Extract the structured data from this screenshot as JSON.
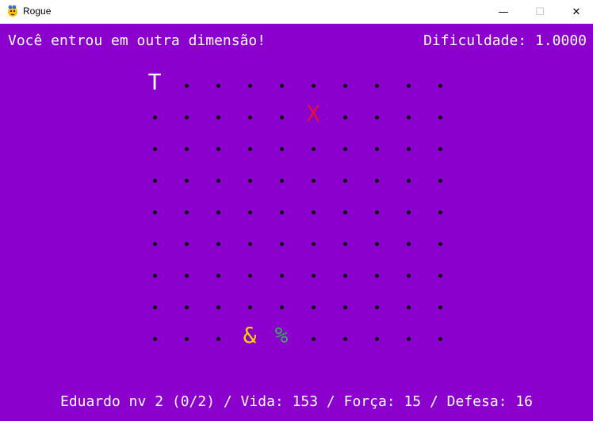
{
  "window": {
    "title": "Rogue",
    "minimize_glyph": "—",
    "maximize_glyph": "☐",
    "close_glyph": "✕"
  },
  "colors": {
    "background": "#8b00cc",
    "player": "#ffffff",
    "enemy": "#e0103a",
    "item_gold": "#ffd400",
    "item_green": "#3aa85a"
  },
  "header": {
    "message": "Você entrou em outra dimensão!",
    "difficulty": "Dificuldade: 1.0000"
  },
  "status": {
    "text": "Eduardo nv 2 (0/2) / Vida: 153 / Força: 15 / Defesa: 16"
  },
  "map": {
    "cols": 10,
    "rows": 9,
    "floor_glyph": "•",
    "entities": [
      {
        "name": "player",
        "glyph": "T",
        "col": 0,
        "row": 0,
        "color": "#ffffff"
      },
      {
        "name": "enemy",
        "glyph": "X",
        "col": 5,
        "row": 1,
        "color": "#e0103a"
      },
      {
        "name": "item-ampersand",
        "glyph": "&",
        "col": 3,
        "row": 8,
        "color": "#ffd400"
      },
      {
        "name": "item-percent",
        "glyph": "%",
        "col": 4,
        "row": 8,
        "color": "#3aa85a"
      }
    ]
  }
}
